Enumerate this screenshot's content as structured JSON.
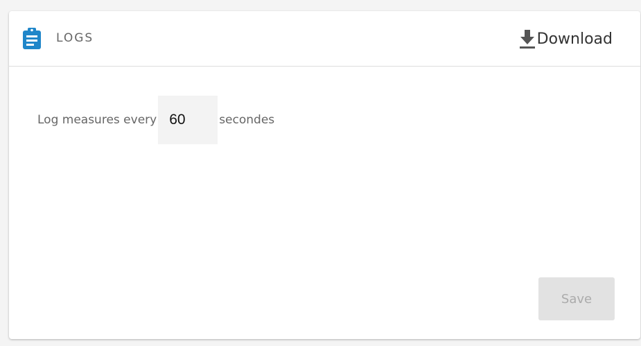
{
  "header": {
    "title": "LOGS",
    "icon": "clipboard-icon",
    "download_label": "Download",
    "download_icon": "download-icon"
  },
  "settings": {
    "prefix_label": "Log measures every",
    "interval_value": "60",
    "suffix_label": "secondes"
  },
  "actions": {
    "save_label": "Save",
    "save_disabled": true
  },
  "colors": {
    "accent": "#1f86c9",
    "text_muted": "#666666",
    "save_bg": "#e2e2e2"
  }
}
